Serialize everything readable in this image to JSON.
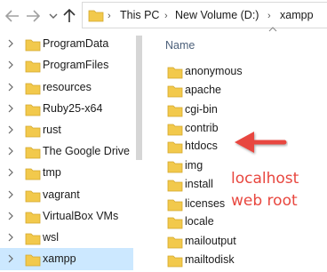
{
  "address_bar": {
    "breadcrumbs": [
      "This PC",
      "New Volume (D:)",
      "xampp"
    ]
  },
  "navigation_pane": {
    "items": [
      {
        "label": "ProgramData"
      },
      {
        "label": "ProgramFiles"
      },
      {
        "label": "resources"
      },
      {
        "label": "Ruby25-x64"
      },
      {
        "label": "rust"
      },
      {
        "label": "The Google Drive"
      },
      {
        "label": "tmp"
      },
      {
        "label": "vagrant"
      },
      {
        "label": "VirtualBox VMs"
      },
      {
        "label": "wsl"
      },
      {
        "label": "xampp",
        "selected": true
      }
    ]
  },
  "content_pane": {
    "column_header": "Name",
    "folders": [
      "anonymous",
      "apache",
      "cgi-bin",
      "contrib",
      "htdocs",
      "img",
      "install",
      "licenses",
      "locale",
      "mailoutput",
      "mailtodisk"
    ]
  },
  "annotation": {
    "line1": "localhost",
    "line2": "web root",
    "color": "#e8473f",
    "target": "htdocs"
  },
  "colors": {
    "folder": "#f2c94c",
    "selection": "#cce8ff"
  }
}
